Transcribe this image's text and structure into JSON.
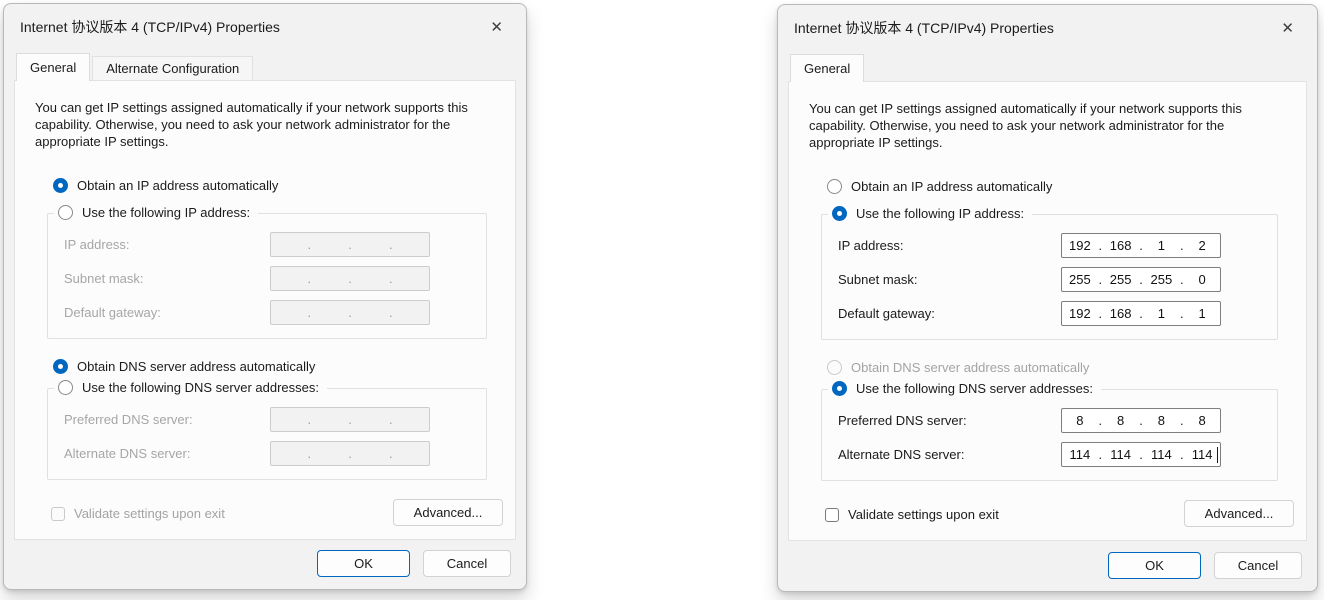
{
  "colors": {
    "accent": "#0067c0"
  },
  "separator": ".",
  "left_dialog": {
    "title": "Internet 协议版本 4 (TCP/IPv4) Properties",
    "close_icon": "✕",
    "tabs": {
      "general": "General",
      "alternate": "Alternate Configuration"
    },
    "description": "You can get IP settings assigned automatically if your network supports this capability. Otherwise, you need to ask your network administrator for the appropriate IP settings.",
    "ip_section": {
      "auto_radio": "Obtain an IP address automatically",
      "manual_radio": "Use the following IP address:",
      "fields": [
        {
          "label": "IP address:",
          "segments": [
            "",
            "",
            "",
            ""
          ]
        },
        {
          "label": "Subnet mask:",
          "segments": [
            "",
            "",
            "",
            ""
          ]
        },
        {
          "label": "Default gateway:",
          "segments": [
            "",
            "",
            "",
            ""
          ]
        }
      ]
    },
    "dns_section": {
      "auto_radio": "Obtain DNS server address automatically",
      "manual_radio": "Use the following DNS server addresses:",
      "fields": [
        {
          "label": "Preferred DNS server:",
          "segments": [
            "",
            "",
            "",
            ""
          ]
        },
        {
          "label": "Alternate DNS server:",
          "segments": [
            "",
            "",
            "",
            ""
          ]
        }
      ]
    },
    "validate_label": "Validate settings upon exit",
    "buttons": {
      "advanced": "Advanced...",
      "ok": "OK",
      "cancel": "Cancel"
    }
  },
  "right_dialog": {
    "title": "Internet 协议版本 4 (TCP/IPv4) Properties",
    "close_icon": "✕",
    "tabs": {
      "general": "General"
    },
    "description": "You can get IP settings assigned automatically if your network supports this capability. Otherwise, you need to ask your network administrator for the appropriate IP settings.",
    "ip_section": {
      "auto_radio": "Obtain an IP address automatically",
      "manual_radio": "Use the following IP address:",
      "fields": [
        {
          "label": "IP address:",
          "segments": [
            "192",
            "168",
            "1",
            "2"
          ]
        },
        {
          "label": "Subnet mask:",
          "segments": [
            "255",
            "255",
            "255",
            "0"
          ]
        },
        {
          "label": "Default gateway:",
          "segments": [
            "192",
            "168",
            "1",
            "1"
          ]
        }
      ]
    },
    "dns_section": {
      "auto_radio": "Obtain DNS server address automatically",
      "manual_radio": "Use the following DNS server addresses:",
      "fields": [
        {
          "label": "Preferred DNS server:",
          "segments": [
            "8",
            "8",
            "8",
            "8"
          ]
        },
        {
          "label": "Alternate DNS server:",
          "segments": [
            "114",
            "114",
            "114",
            "114"
          ]
        }
      ]
    },
    "validate_label": "Validate settings upon exit",
    "buttons": {
      "advanced": "Advanced...",
      "ok": "OK",
      "cancel": "Cancel"
    }
  }
}
